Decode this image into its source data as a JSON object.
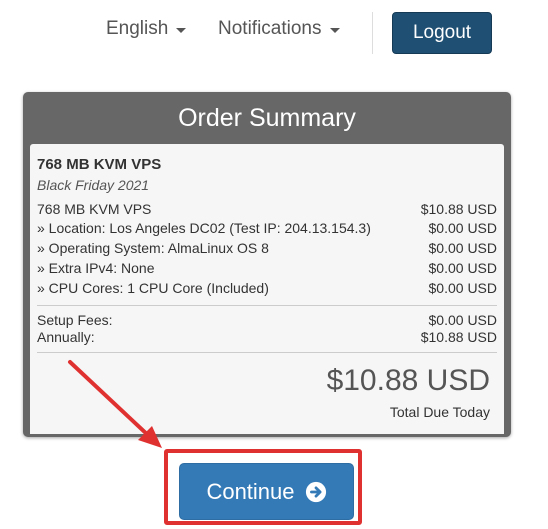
{
  "nav": {
    "language_label": "English",
    "notifications_label": "Notifications",
    "logout_label": "Logout"
  },
  "summary": {
    "title": "Order Summary",
    "product_name": "768 MB KVM VPS",
    "product_group": "Black Friday 2021",
    "items": [
      {
        "label": "768 MB KVM VPS",
        "price": "$10.88 USD"
      },
      {
        "label": "» Location: Los Angeles DC02 (Test IP: 204.13.154.3)",
        "price": "$0.00 USD"
      },
      {
        "label": "» Operating System: AlmaLinux OS 8",
        "price": "$0.00 USD"
      },
      {
        "label": "» Extra IPv4: None",
        "price": "$0.00 USD"
      },
      {
        "label": "» CPU Cores: 1 CPU Core (Included)",
        "price": "$0.00 USD"
      }
    ],
    "fees": [
      {
        "label": "Setup Fees:",
        "price": "$0.00 USD"
      },
      {
        "label": "Annually:",
        "price": "$10.88 USD"
      }
    ],
    "total_amount": "$10.88 USD",
    "total_label": "Total Due Today"
  },
  "actions": {
    "continue_label": "Continue"
  },
  "colors": {
    "logout_bg": "#1f4f72",
    "continue_bg": "#337ab7",
    "panel_header": "#676767",
    "annotation": "#e03131"
  }
}
